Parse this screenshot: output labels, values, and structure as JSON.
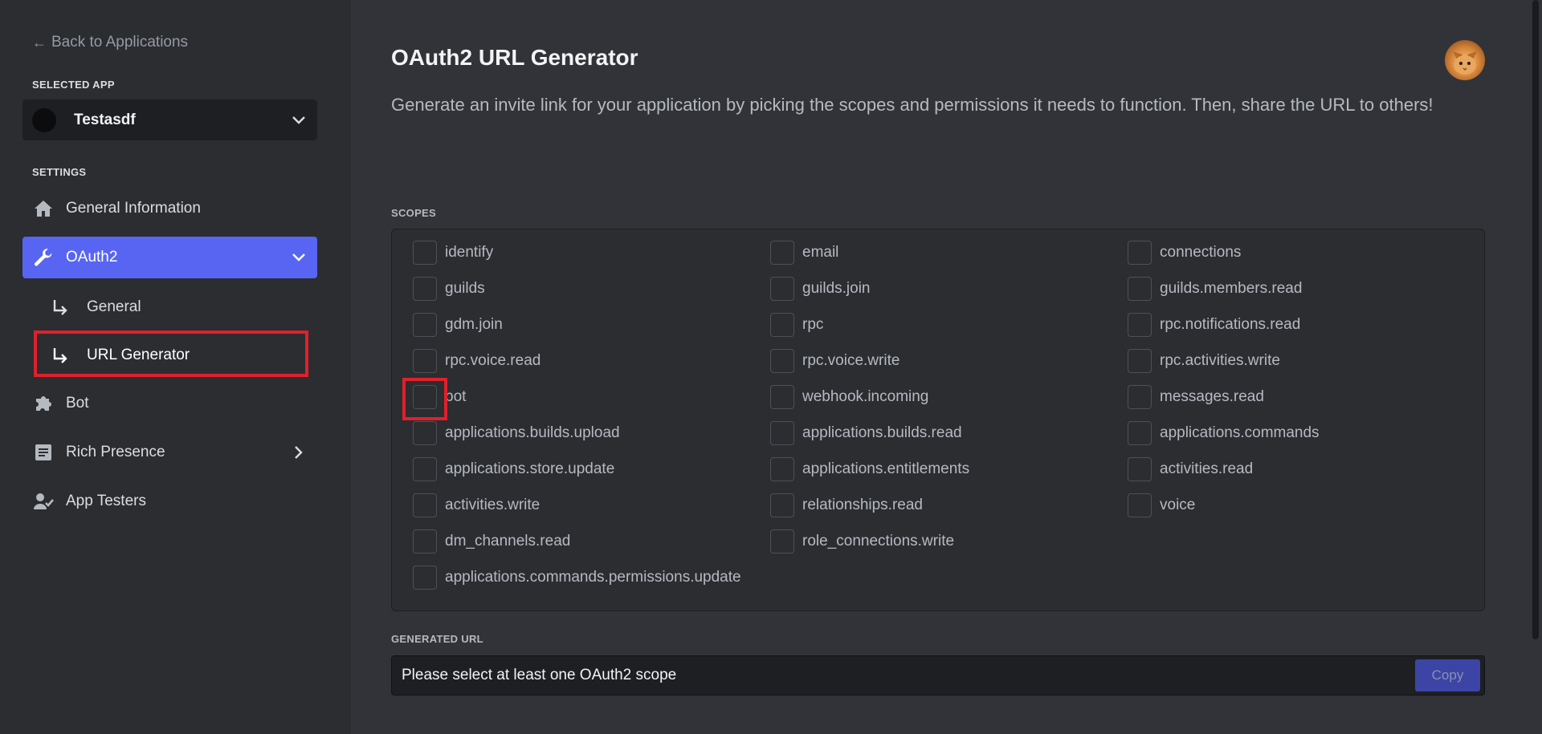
{
  "sidebar": {
    "back_label": "Back to Applications",
    "selected_app_label": "SELECTED APP",
    "app_name": "Testasdf",
    "settings_label": "SETTINGS",
    "items": [
      {
        "label": "General Information",
        "icon": "home-icon"
      },
      {
        "label": "OAuth2",
        "icon": "wrench-icon"
      },
      {
        "label": "Bot",
        "icon": "puzzle-icon"
      },
      {
        "label": "Rich Presence",
        "icon": "document-icon"
      },
      {
        "label": "App Testers",
        "icon": "person-icon"
      }
    ],
    "oauth2_sub": [
      {
        "label": "General"
      },
      {
        "label": "URL Generator"
      }
    ]
  },
  "main": {
    "title": "OAuth2 URL Generator",
    "description": "Generate an invite link for your application by picking the scopes and permissions it needs to function. Then, share the URL to others!",
    "scopes_label": "SCOPES",
    "scopes": [
      "identify",
      "email",
      "connections",
      "guilds",
      "guilds.join",
      "guilds.members.read",
      "gdm.join",
      "rpc",
      "rpc.notifications.read",
      "rpc.voice.read",
      "rpc.voice.write",
      "rpc.activities.write",
      "bot",
      "webhook.incoming",
      "messages.read",
      "applications.builds.upload",
      "applications.builds.read",
      "applications.commands",
      "applications.store.update",
      "applications.entitlements",
      "activities.read",
      "activities.write",
      "relationships.read",
      "voice",
      "dm_channels.read",
      "role_connections.write",
      "applications.commands.permissions.update"
    ],
    "generated_url_label": "GENERATED URL",
    "generated_url_placeholder": "Please select at least one OAuth2 scope",
    "copy_label": "Copy"
  },
  "colors": {
    "accent": "#5865f2",
    "highlight": "#e0202b"
  }
}
